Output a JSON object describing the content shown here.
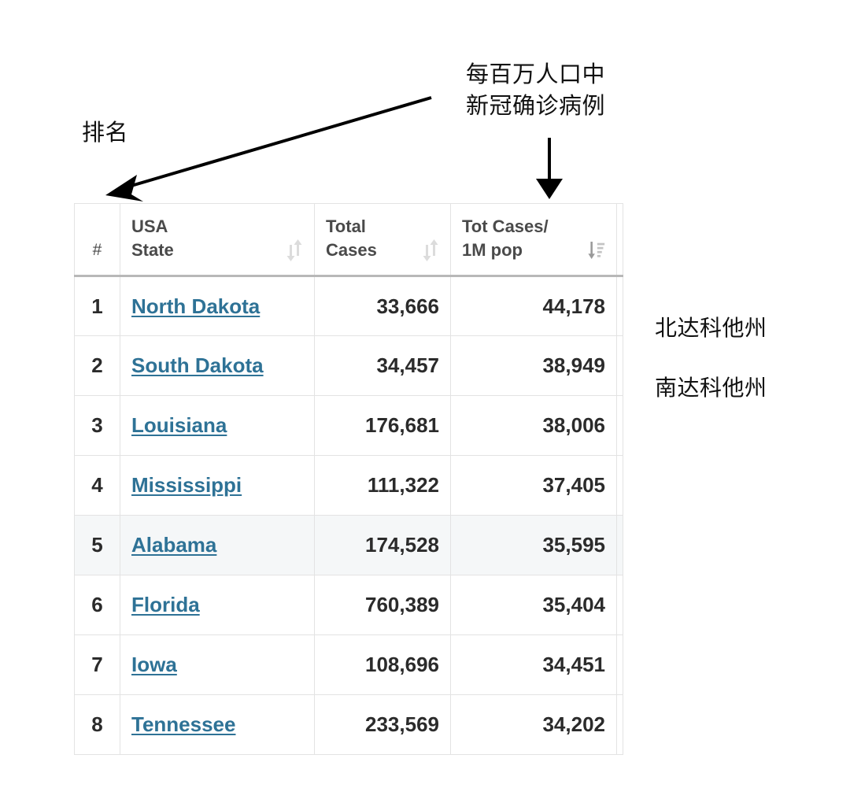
{
  "annotations": {
    "rank_label": "排名",
    "per_million_label": "每百万人口中\n新冠确诊病例",
    "north_dakota_cn": "北达科他州",
    "south_dakota_cn": "南达科他州"
  },
  "table": {
    "columns": [
      {
        "key": "rank",
        "label": "#",
        "sort": "none"
      },
      {
        "key": "state",
        "label": "USA\nState",
        "sort": "both"
      },
      {
        "key": "total",
        "label": "Total\nCases",
        "sort": "both"
      },
      {
        "key": "per1m",
        "label": "Tot Cases/\n1M pop",
        "sort": "desc"
      }
    ],
    "rows": [
      {
        "rank": "1",
        "state": "North Dakota",
        "total": "33,666",
        "per1m": "44,178",
        "highlight": false
      },
      {
        "rank": "2",
        "state": "South Dakota",
        "total": "34,457",
        "per1m": "38,949",
        "highlight": false
      },
      {
        "rank": "3",
        "state": "Louisiana",
        "total": "176,681",
        "per1m": "38,006",
        "highlight": false
      },
      {
        "rank": "4",
        "state": "Mississippi",
        "total": "111,322",
        "per1m": "37,405",
        "highlight": false
      },
      {
        "rank": "5",
        "state": "Alabama",
        "total": "174,528",
        "per1m": "35,595",
        "highlight": true
      },
      {
        "rank": "6",
        "state": "Florida",
        "total": "760,389",
        "per1m": "35,404",
        "highlight": false
      },
      {
        "rank": "7",
        "state": "Iowa",
        "total": "108,696",
        "per1m": "34,451",
        "highlight": false
      },
      {
        "rank": "8",
        "state": "Tennessee",
        "total": "233,569",
        "per1m": "34,202",
        "highlight": false
      }
    ]
  },
  "colors": {
    "link": "#2e7296",
    "text": "#2b2b2b",
    "header_text": "#4a4a4a",
    "rank_text": "#8d8d8d",
    "border": "#e3e3e3",
    "header_rule": "#b8b8b8",
    "row_highlight": "#f5f7f8",
    "sort_inactive": "#dcdcdc",
    "sort_active": "#9a9a9a",
    "annotation": "#111111"
  }
}
